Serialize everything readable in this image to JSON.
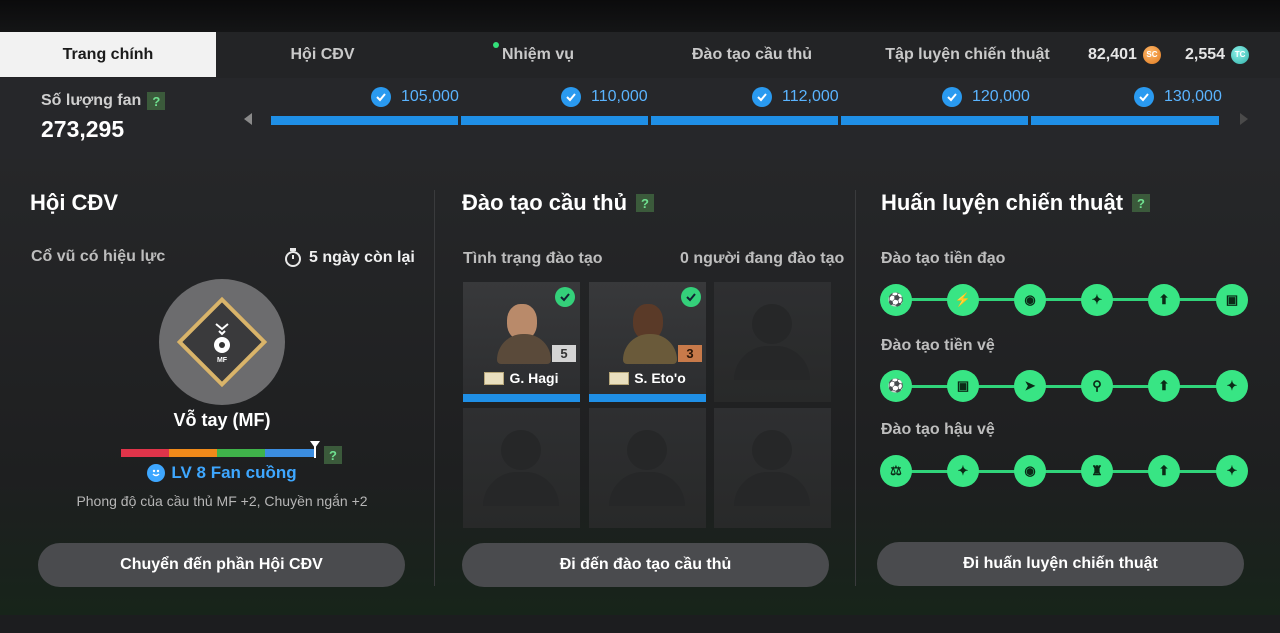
{
  "tabs": [
    {
      "label": "Trang chính",
      "active": true
    },
    {
      "label": "Hội CĐV"
    },
    {
      "label": "Nhiệm vụ",
      "has_dot": true
    },
    {
      "label": "Đào tạo cầu thủ"
    },
    {
      "label": "Tập luyện chiến thuật"
    }
  ],
  "currency": {
    "sc_amount": "82,401",
    "sc_icon": "SC",
    "tc_amount": "2,554",
    "tc_icon": "TC"
  },
  "fans": {
    "label": "Số lượng fan",
    "help": "?",
    "value": "273,295",
    "milestones": [
      "105,000",
      "110,000",
      "112,000",
      "120,000",
      "130,000"
    ],
    "progress_fraction": 1.0
  },
  "supporters": {
    "title": "Hội CĐV",
    "active_cheer_label": "Cổ vũ có hiệu lực",
    "time_left": "5 ngày còn lại",
    "emblem_position": "MF",
    "cheer_name": "Vỗ tay (MF)",
    "help": "?",
    "level_text": "LV 8 Fan cuồng",
    "level_desc": "Phong độ của cầu thủ MF +2, Chuyền ngắn +2",
    "button": "Chuyển đến phần Hội CĐV"
  },
  "training": {
    "title": "Đào tạo cầu thủ",
    "help": "?",
    "status_label": "Tình trạng đào tạo",
    "count_label": "0 người đang đào tạo",
    "players": [
      {
        "name": "G. Hagi",
        "level": "5",
        "level_color": "#b8b8b8"
      },
      {
        "name": "S. Eto'o",
        "level": "3",
        "level_color": "#c87a4a"
      }
    ],
    "button": "Đi đến đào tạo cầu thủ"
  },
  "tactics": {
    "title": "Huấn luyện chiến thuật",
    "help": "?",
    "rows": [
      {
        "label": "Đào tạo tiền đạo",
        "icons": [
          "player-ball-icon",
          "lightning-icon",
          "ball-icon",
          "boot-icon",
          "shirt-arrow-icon",
          "goal-icon"
        ]
      },
      {
        "label": "Đào tạo tiền vệ",
        "icons": [
          "player-ball-icon",
          "goal-icon",
          "ball-speed-icon",
          "position-marker-icon",
          "shirt-arrow-icon",
          "boot-icon"
        ]
      },
      {
        "label": "Đào tạo hậu vệ",
        "icons": [
          "weightlifting-icon",
          "boot-icon",
          "ball-arrow-icon",
          "helmet-icon",
          "shirt-arrow-icon",
          "boot-icon"
        ]
      }
    ],
    "button": "Đi huấn luyện chiến thuật"
  },
  "colors": {
    "accent_blue": "#1f8fe6",
    "accent_green": "#38e584",
    "level_bar": [
      "#e0344a",
      "#f08a1a",
      "#3fb34a",
      "#3b8de0"
    ]
  }
}
